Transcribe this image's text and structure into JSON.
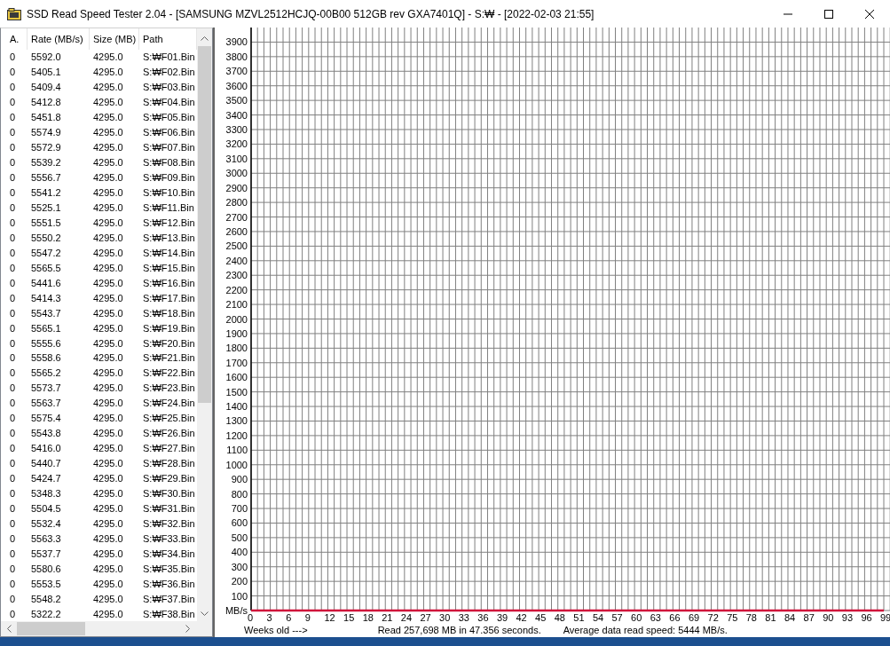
{
  "window": {
    "title": "SSD Read Speed Tester 2.04 - [SAMSUNG MZVL2512HCJQ-00B00 512GB rev GXA7401Q] - S:₩ - [2022-02-03 21:55]"
  },
  "table": {
    "columns": [
      "A.",
      "Rate (MB/s)",
      "Size (MB)",
      "Path"
    ],
    "rows": [
      [
        "0",
        "5592.0",
        "4295.0",
        "S:₩F01.Bin"
      ],
      [
        "0",
        "5405.1",
        "4295.0",
        "S:₩F02.Bin"
      ],
      [
        "0",
        "5409.4",
        "4295.0",
        "S:₩F03.Bin"
      ],
      [
        "0",
        "5412.8",
        "4295.0",
        "S:₩F04.Bin"
      ],
      [
        "0",
        "5451.8",
        "4295.0",
        "S:₩F05.Bin"
      ],
      [
        "0",
        "5574.9",
        "4295.0",
        "S:₩F06.Bin"
      ],
      [
        "0",
        "5572.9",
        "4295.0",
        "S:₩F07.Bin"
      ],
      [
        "0",
        "5539.2",
        "4295.0",
        "S:₩F08.Bin"
      ],
      [
        "0",
        "5556.7",
        "4295.0",
        "S:₩F09.Bin"
      ],
      [
        "0",
        "5541.2",
        "4295.0",
        "S:₩F10.Bin"
      ],
      [
        "0",
        "5525.1",
        "4295.0",
        "S:₩F11.Bin"
      ],
      [
        "0",
        "5551.5",
        "4295.0",
        "S:₩F12.Bin"
      ],
      [
        "0",
        "5550.2",
        "4295.0",
        "S:₩F13.Bin"
      ],
      [
        "0",
        "5547.2",
        "4295.0",
        "S:₩F14.Bin"
      ],
      [
        "0",
        "5565.5",
        "4295.0",
        "S:₩F15.Bin"
      ],
      [
        "0",
        "5441.6",
        "4295.0",
        "S:₩F16.Bin"
      ],
      [
        "0",
        "5414.3",
        "4295.0",
        "S:₩F17.Bin"
      ],
      [
        "0",
        "5543.7",
        "4295.0",
        "S:₩F18.Bin"
      ],
      [
        "0",
        "5565.1",
        "4295.0",
        "S:₩F19.Bin"
      ],
      [
        "0",
        "5555.6",
        "4295.0",
        "S:₩F20.Bin"
      ],
      [
        "0",
        "5558.6",
        "4295.0",
        "S:₩F21.Bin"
      ],
      [
        "0",
        "5565.2",
        "4295.0",
        "S:₩F22.Bin"
      ],
      [
        "0",
        "5573.7",
        "4295.0",
        "S:₩F23.Bin"
      ],
      [
        "0",
        "5563.7",
        "4295.0",
        "S:₩F24.Bin"
      ],
      [
        "0",
        "5575.4",
        "4295.0",
        "S:₩F25.Bin"
      ],
      [
        "0",
        "5543.8",
        "4295.0",
        "S:₩F26.Bin"
      ],
      [
        "0",
        "5416.0",
        "4295.0",
        "S:₩F27.Bin"
      ],
      [
        "0",
        "5440.7",
        "4295.0",
        "S:₩F28.Bin"
      ],
      [
        "0",
        "5424.7",
        "4295.0",
        "S:₩F29.Bin"
      ],
      [
        "0",
        "5348.3",
        "4295.0",
        "S:₩F30.Bin"
      ],
      [
        "0",
        "5504.5",
        "4295.0",
        "S:₩F31.Bin"
      ],
      [
        "0",
        "5532.4",
        "4295.0",
        "S:₩F32.Bin"
      ],
      [
        "0",
        "5563.3",
        "4295.0",
        "S:₩F33.Bin"
      ],
      [
        "0",
        "5537.7",
        "4295.0",
        "S:₩F34.Bin"
      ],
      [
        "0",
        "5580.6",
        "4295.0",
        "S:₩F35.Bin"
      ],
      [
        "0",
        "5553.5",
        "4295.0",
        "S:₩F36.Bin"
      ],
      [
        "0",
        "5548.2",
        "4295.0",
        "S:₩F37.Bin"
      ],
      [
        "0",
        "5322.2",
        "4295.0",
        "S:₩F38.Bin"
      ]
    ]
  },
  "chart": {
    "chart_data": {
      "type": "line",
      "xlabel": "Weeks old --->",
      "x": [
        0,
        99
      ],
      "series": [
        {
          "color": "#d0103a",
          "values": [
            0,
            0
          ]
        }
      ],
      "grid": true,
      "xlim": [
        0,
        99
      ],
      "ylim": [
        0,
        4000
      ],
      "xticks": [
        0,
        3,
        6,
        9,
        12,
        15,
        18,
        21,
        24,
        27,
        30,
        33,
        36,
        39,
        42,
        45,
        48,
        51,
        54,
        57,
        60,
        63,
        66,
        69,
        72,
        75,
        78,
        81,
        84,
        87,
        90,
        93,
        96,
        99
      ],
      "yticks": [
        {
          "value": 0,
          "label": "MB/s"
        },
        100,
        200,
        300,
        400,
        500,
        600,
        700,
        800,
        900,
        1000,
        1100,
        1200,
        1300,
        1400,
        1500,
        1600,
        1700,
        1800,
        1900,
        2000,
        2100,
        2200,
        2300,
        2400,
        2500,
        2600,
        2700,
        2800,
        2900,
        3000,
        3100,
        3200,
        3300,
        3400,
        3500,
        3600,
        3700,
        3800,
        3900
      ]
    },
    "status": [
      "Read 257,698 MB in 47.356 seconds.",
      "Average data read speed: 5444 MB/s."
    ]
  }
}
